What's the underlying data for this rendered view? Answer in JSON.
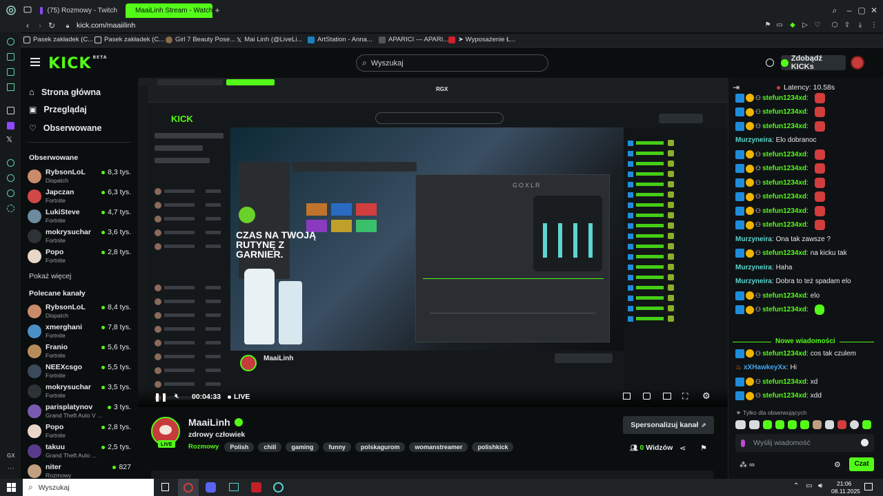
{
  "browser": {
    "tabs": [
      {
        "label": "(75) Rozmowy - Twitch",
        "active": false
      },
      {
        "label": "MaaiLinh Stream - Watch",
        "active": true
      }
    ],
    "url": "kick.com/maaiilinh",
    "bookmarks": [
      {
        "label": "Pasek zakładek (C..."
      },
      {
        "label": "Pasek zakładek (C..."
      },
      {
        "label": "Girl 7 Beauty Pose..."
      },
      {
        "label": "Mai Linh (@LiveLi..."
      },
      {
        "label": "ArtStation - Anna..."
      },
      {
        "label": "APARICI — APARI..."
      },
      {
        "label": "➤ Wyposażenie Ł..."
      }
    ]
  },
  "header": {
    "logo": "KICK",
    "logo_badge": "BETA",
    "search_placeholder": "Wyszukaj",
    "kicks_button": "Zdobądź KICKs"
  },
  "sidebar": {
    "nav": [
      {
        "label": "Strona główna",
        "icon": "home-icon"
      },
      {
        "label": "Przeglądaj",
        "icon": "browse-icon"
      },
      {
        "label": "Obserwowane",
        "icon": "heart-icon"
      }
    ],
    "followed_title": "Obserwowane",
    "followed": [
      {
        "name": "RybsonLoL",
        "game": "Dispatch",
        "viewers": "8,3 tys.",
        "color": "#c98b6a"
      },
      {
        "name": "Japczan",
        "game": "Fortnite",
        "viewers": "6,3 tys.",
        "color": "#d14848"
      },
      {
        "name": "LukiSteve",
        "game": "Fortnite",
        "viewers": "4,7 tys.",
        "color": "#6d8a9e"
      },
      {
        "name": "mokrysuchar",
        "game": "Fortnite",
        "viewers": "3,6 tys.",
        "color": "#2d3236"
      },
      {
        "name": "Popo",
        "game": "Fortnite",
        "viewers": "2,8 tys.",
        "color": "#e8d7c8"
      }
    ],
    "show_more": "Pokaż więcej",
    "recommended_title": "Polecane kanały",
    "recommended": [
      {
        "name": "RybsonLoL",
        "game": "Dispatch",
        "viewers": "8,4 tys.",
        "color": "#c98b6a"
      },
      {
        "name": "xmerghani",
        "game": "Fortnite",
        "viewers": "7,8 tys.",
        "color": "#4a90c8"
      },
      {
        "name": "Franio",
        "game": "Fortnite",
        "viewers": "5,6 tys.",
        "color": "#b88c5a"
      },
      {
        "name": "NEEXcsgo",
        "game": "Fortnite",
        "viewers": "5,5 tys.",
        "color": "#3a4a5a"
      },
      {
        "name": "mokrysuchar",
        "game": "Fortnite",
        "viewers": "3,5 tys.",
        "color": "#2d3236"
      },
      {
        "name": "parisplatynov",
        "game": "Grand Theft Auto V ...",
        "viewers": "3 tys.",
        "color": "#7a5ab0"
      },
      {
        "name": "Popo",
        "game": "Fortnite",
        "viewers": "2,8 tys.",
        "color": "#e8d7c8"
      },
      {
        "name": "takuu",
        "game": "Grand Theft Auto ...",
        "viewers": "2,5 tys.",
        "color": "#5a3a8a"
      },
      {
        "name": "niter",
        "game": "Rozmowy",
        "viewers": "827",
        "color": "#c0a080"
      }
    ]
  },
  "player": {
    "time": "00:04:33",
    "live_label": "LIVE",
    "inner_ad": "CZAS NA TWOJĄ RUTYNĘ Z GARNIER.",
    "inner_overlay_label": "RGX"
  },
  "channel": {
    "name": "MaaiLinh",
    "live_badge": "LIVE",
    "title": "zdrowy człowiek",
    "category": "Rozmowy",
    "tags": [
      "Polish",
      "chill",
      "gaming",
      "funny",
      "polskagurom",
      "womanstreamer",
      "polishkick"
    ],
    "customize_button": "Spersonalizuj kanał",
    "viewers": "0",
    "viewers_label": "Widzów"
  },
  "chat": {
    "latency": "Latency: 10.58s",
    "messages": [
      {
        "user": "stefun1234xd",
        "text": "",
        "badges": true,
        "emote": "red"
      },
      {
        "user": "stefun1234xd",
        "text": "",
        "badges": true,
        "emote": "red"
      },
      {
        "user": "stefun1234xd",
        "text": "",
        "badges": true,
        "emote": "red"
      },
      {
        "user": "Murzyneira",
        "text": "Elo dobranoc",
        "badges": false,
        "emote": ""
      },
      {
        "user": "stefun1234xd",
        "text": "",
        "badges": true,
        "emote": "red"
      },
      {
        "user": "stefun1234xd",
        "text": "",
        "badges": true,
        "emote": "red"
      },
      {
        "user": "stefun1234xd",
        "text": "",
        "badges": true,
        "emote": "red"
      },
      {
        "user": "stefun1234xd",
        "text": "",
        "badges": true,
        "emote": "red"
      },
      {
        "user": "stefun1234xd",
        "text": "",
        "badges": true,
        "emote": "red"
      },
      {
        "user": "stefun1234xd",
        "text": "",
        "badges": true,
        "emote": "red"
      },
      {
        "user": "Murzyneira",
        "text": "Ona tak zawsze ?",
        "badges": false,
        "emote": ""
      },
      {
        "user": "stefun1234xd",
        "text": "na kicku tak",
        "badges": true,
        "emote": ""
      },
      {
        "user": "Murzyneira",
        "text": "Haha",
        "badges": false,
        "emote": ""
      },
      {
        "user": "Murzyneira",
        "text": "Dobra to też spadam elo",
        "badges": false,
        "emote": ""
      },
      {
        "user": "stefun1234xd",
        "text": "elo",
        "badges": true,
        "emote": ""
      },
      {
        "user": "stefun1234xd",
        "text": "",
        "badges": true,
        "emote": "green"
      }
    ],
    "new_messages": "Nowe wiadomości",
    "messages_after": [
      {
        "user": "stefun1234xd",
        "text": "cos tak czulem",
        "badges": true,
        "kind": "stefun"
      },
      {
        "user": "xXHawkeyXx",
        "text": "Hi",
        "badges": false,
        "kind": "hawk"
      },
      {
        "user": "stefun1234xd",
        "text": "xd",
        "badges": true,
        "kind": "stefun"
      },
      {
        "user": "stefun1234xd",
        "text": "xdd",
        "badges": true,
        "kind": "stefun"
      }
    ],
    "followers_only": "Tylko dla obserwujących",
    "input_placeholder": "Wyślij wiadomość",
    "send_button": "Czat"
  },
  "taskbar": {
    "search_placeholder": "Wyszukaj",
    "time": "21:06",
    "date": "08.11.2025"
  },
  "colors": {
    "brand": "#53fc18",
    "background": "#0b0e0f",
    "chat_bg": "#0f1214"
  }
}
